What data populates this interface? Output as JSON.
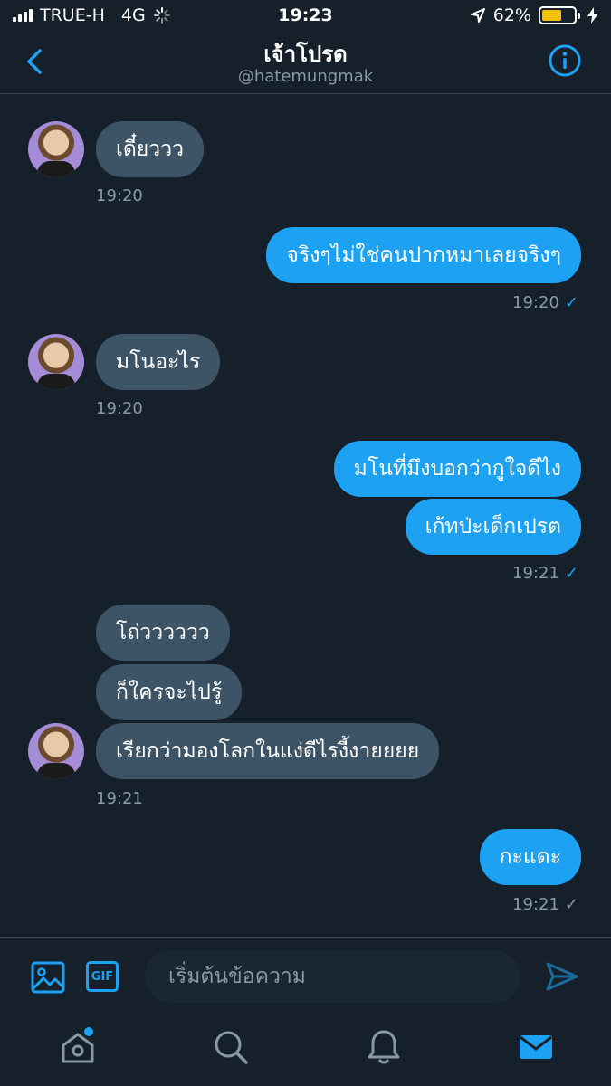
{
  "status": {
    "carrier": "TRUE-H",
    "network": "4G",
    "time": "19:23",
    "battery_percent": "62%",
    "battery_level": 0.62,
    "battery_color": "#f5c100"
  },
  "header": {
    "title": "เจ้าโปรด",
    "handle": "@hatemungmak"
  },
  "messages": [
    {
      "side": "in",
      "text": "เดี๋ยววว",
      "time": "19:20"
    },
    {
      "side": "out",
      "text": "จริงๆไม่ใช่คนปากหมาเลยจริงๆ",
      "time": "19:20",
      "check": "✓"
    },
    {
      "side": "in",
      "text": "มโนอะไร",
      "time": "19:20"
    },
    {
      "side": "out",
      "text": "มโนที่มึงบอกว่ากูใจดีไง"
    },
    {
      "side": "out",
      "text": "เก้ทป่ะเด็กเปรต",
      "time": "19:21",
      "check": "✓"
    },
    {
      "side": "in",
      "text": "โถ่วววววว"
    },
    {
      "side": "in",
      "text": "ก็ใครจะไปรู้"
    },
    {
      "side": "in",
      "text": "เรียกว่ามองโลกในแง่ดีไรงี้งายยยย",
      "time": "19:21"
    },
    {
      "side": "out",
      "text": "กะแดะ",
      "time": "19:21",
      "check": "✓"
    }
  ],
  "composer": {
    "placeholder": "เริ่มต้นข้อความ",
    "gif_label": "GIF"
  },
  "colors": {
    "background": "#15202b",
    "accent": "#1da1f2",
    "incoming_bubble": "#3d5466",
    "muted_text": "#8899a6"
  },
  "icons": [
    "back-icon",
    "info-icon",
    "image-icon",
    "gif-icon",
    "send-icon",
    "home-icon",
    "search-icon",
    "bell-icon",
    "mail-icon"
  ]
}
